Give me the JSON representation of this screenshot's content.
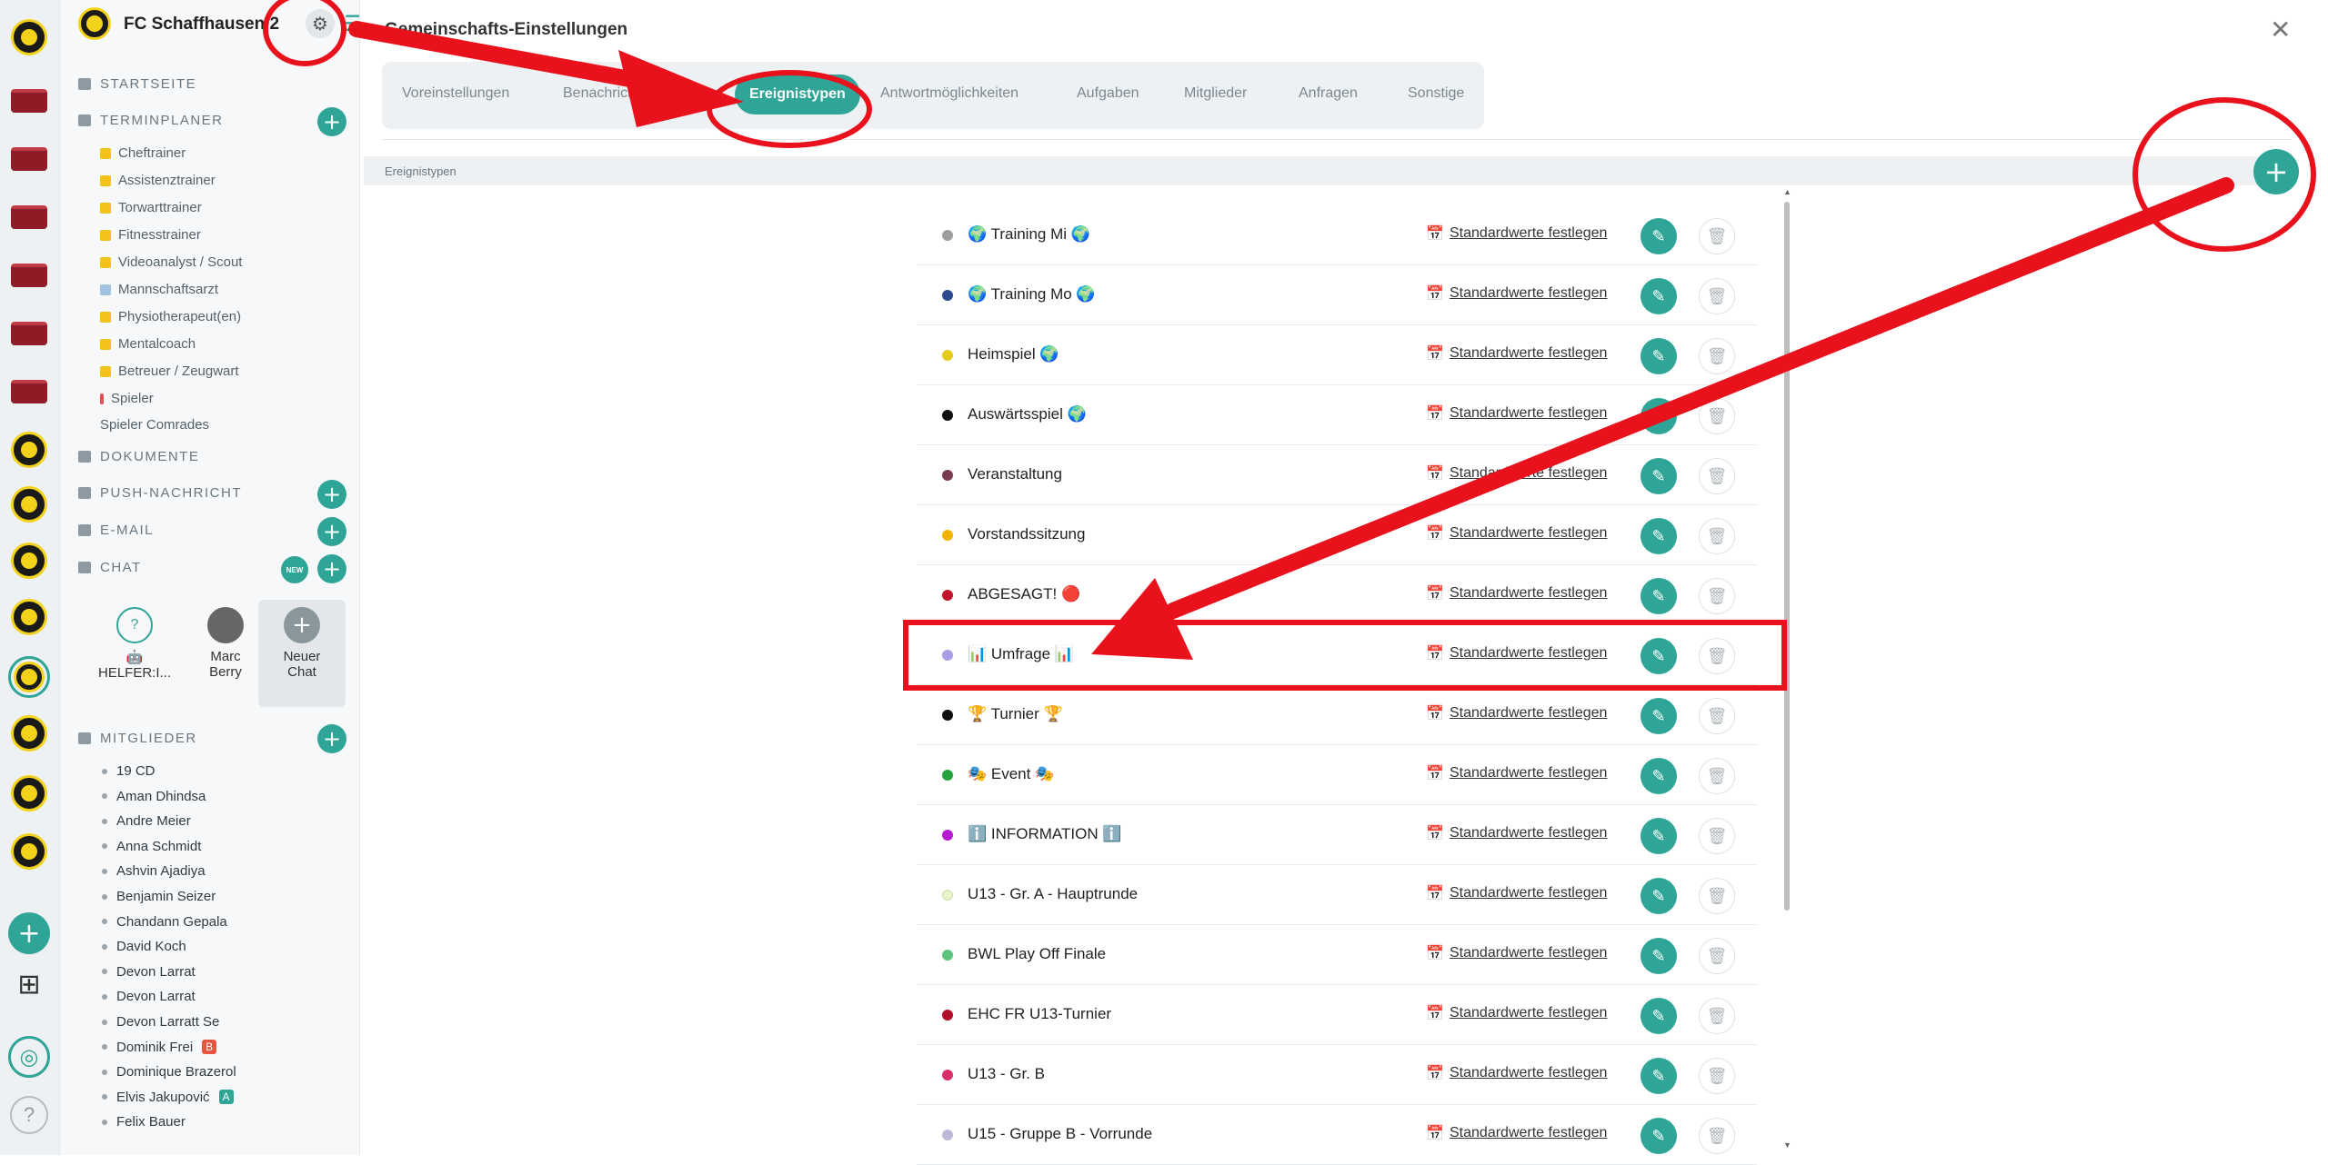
{
  "team_name": "FC Schaffhausen 2",
  "header": {
    "title": "Gemeinschafts-Einstellungen",
    "close": "✕"
  },
  "tabs": [
    "Voreinstellungen",
    "Benachrichtigungen",
    "Ereignistypen",
    "Antwortmöglichkeiten",
    "Aufgaben",
    "Mitglieder",
    "Anfragen",
    "Sonstige"
  ],
  "active_tab": "Ereignistypen",
  "section_label": "Ereignistypen",
  "sidebar": {
    "startseite": "STARTSEITE",
    "terminplaner": "TERMINPLANER",
    "terminplaner_items": [
      "Cheftrainer",
      "Assistenztrainer",
      "Torwarttrainer",
      "Fitnesstrainer",
      "Videoanalyst / Scout",
      "Mannschaftsarzt",
      "Physiotherapeut(en)",
      "Mentalcoach",
      "Betreuer / Zeugwart",
      "Spieler"
    ],
    "spieler_comrades": "Spieler Comrades",
    "dokumente": "DOKUMENTE",
    "push": "PUSH-NACHRICHT",
    "email": "E-MAIL",
    "chat": "CHAT",
    "new_badge": "NEW",
    "chat_tiles": [
      {
        "line1": "🤖",
        "line2": "HELFER:I..."
      },
      {
        "line1": "Marc",
        "line2": "Berry"
      },
      {
        "line1": "Neuer",
        "line2": "Chat"
      }
    ],
    "mitglieder": "MITGLIEDER",
    "members": [
      {
        "name": "19 CD",
        "tag": ""
      },
      {
        "name": "Aman Dhindsa",
        "tag": ""
      },
      {
        "name": "Andre Meier",
        "tag": ""
      },
      {
        "name": "Anna Schmidt",
        "tag": ""
      },
      {
        "name": "Ashvin Ajadiya",
        "tag": ""
      },
      {
        "name": "Benjamin Seizer",
        "tag": ""
      },
      {
        "name": "Chandann Gepala",
        "tag": ""
      },
      {
        "name": "David Koch",
        "tag": ""
      },
      {
        "name": "Devon Larrat",
        "tag": ""
      },
      {
        "name": "Devon Larrat",
        "tag": ""
      },
      {
        "name": "Devon Larratt Se",
        "tag": ""
      },
      {
        "name": "Dominik Frei",
        "tag": "B"
      },
      {
        "name": "Dominique Brazerol",
        "tag": ""
      },
      {
        "name": "Elvis Jakupović",
        "tag": "A"
      },
      {
        "name": "Felix Bauer",
        "tag": ""
      }
    ]
  },
  "std_label": "Standardwerte festlegen",
  "event_types": [
    {
      "name": "🌍 Training Mi 🌍",
      "color": "#9e9e9e"
    },
    {
      "name": "🌍 Training Mo 🌍",
      "color": "#2b4a8c"
    },
    {
      "name": "Heimspiel 🌍",
      "color": "#e6cc1a"
    },
    {
      "name": "Auswärtsspiel 🌍",
      "color": "#111111"
    },
    {
      "name": "Veranstaltung",
      "color": "#7a3b4e"
    },
    {
      "name": "Vorstandssitzung",
      "color": "#f0b400"
    },
    {
      "name": "ABGESAGT! 🔴",
      "color": "#c0142a"
    },
    {
      "name": "📊 Umfrage 📊",
      "color": "#a99be8"
    },
    {
      "name": "🏆 Turnier 🏆",
      "color": "#111111"
    },
    {
      "name": "🎭 Event 🎭",
      "color": "#27a33c"
    },
    {
      "name": "ℹ️ INFORMATION ℹ️",
      "color": "#b41ad0"
    },
    {
      "name": "U13 - Gr. A - Hauptrunde",
      "color": "#e6f3c8"
    },
    {
      "name": "BWL Play Off Finale",
      "color": "#5cc47c"
    },
    {
      "name": "EHC FR U13-Turnier",
      "color": "#b0102a"
    },
    {
      "name": "U13 - Gr. B",
      "color": "#d9306a"
    },
    {
      "name": "U15 - Gruppe B - Vorrunde",
      "color": "#bdb8d8"
    }
  ]
}
